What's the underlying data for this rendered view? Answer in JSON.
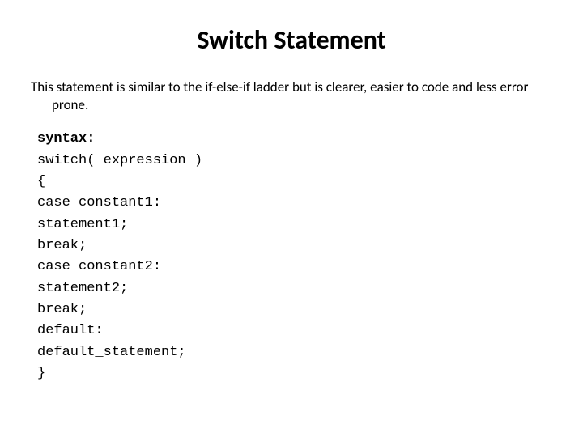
{
  "title": "Switch Statement",
  "description": "This statement is similar to the if-else-if ladder but is clearer, easier to code and less error prone.",
  "code": {
    "label": "syntax:",
    "lines": [
      "switch( expression )",
      "{",
      "case constant1:",
      "statement1;",
      "break;",
      "case constant2:",
      "statement2;",
      "break;",
      "default:",
      "default_statement;",
      "}"
    ]
  }
}
